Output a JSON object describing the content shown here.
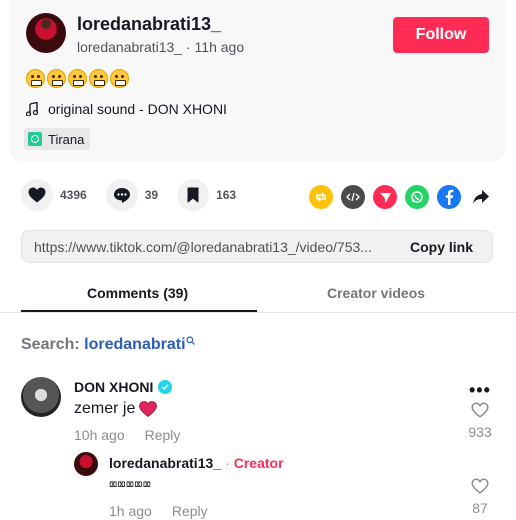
{
  "author": {
    "username": "loredanabrati13_",
    "handle": "loredanabrati13_",
    "time_ago": "11h ago",
    "follow_label": "Follow"
  },
  "caption": {
    "emoji_count": 5,
    "emoji_name": "grimacing-face"
  },
  "sound": {
    "label": "original sound - DON XHONI"
  },
  "location": {
    "label": "Tirana"
  },
  "stats": {
    "likes": "4396",
    "comments": "39",
    "saves": "163"
  },
  "share_icons": [
    "repost-icon",
    "embed-icon",
    "send-icon",
    "whatsapp-icon",
    "facebook-icon",
    "share-arrow-icon"
  ],
  "link": {
    "url": "https://www.tiktok.com/@loredanabrati13_/video/753...",
    "copy_label": "Copy link"
  },
  "tabs": [
    {
      "label": "Comments (39)",
      "active": true
    },
    {
      "label": "Creator videos",
      "active": false
    }
  ],
  "search": {
    "prefix": "Search:",
    "query": "loredanabrati"
  },
  "comments": [
    {
      "username": "DON XHONI",
      "verified": true,
      "text": "zemer je",
      "time_ago": "10h ago",
      "reply_label": "Reply",
      "likes": "933",
      "more_label": "•••"
    }
  ],
  "reply": {
    "username": "loredanabrati13_",
    "separator": "·",
    "badge": "Creator",
    "text": "⌧⌧⌧⌧⌧",
    "time_ago": "1h ago",
    "reply_label": "Reply",
    "likes": "87"
  },
  "colors": {
    "accent": "#fe2c55",
    "search_query": "#2b5db9",
    "verified": "#20d5ec"
  }
}
